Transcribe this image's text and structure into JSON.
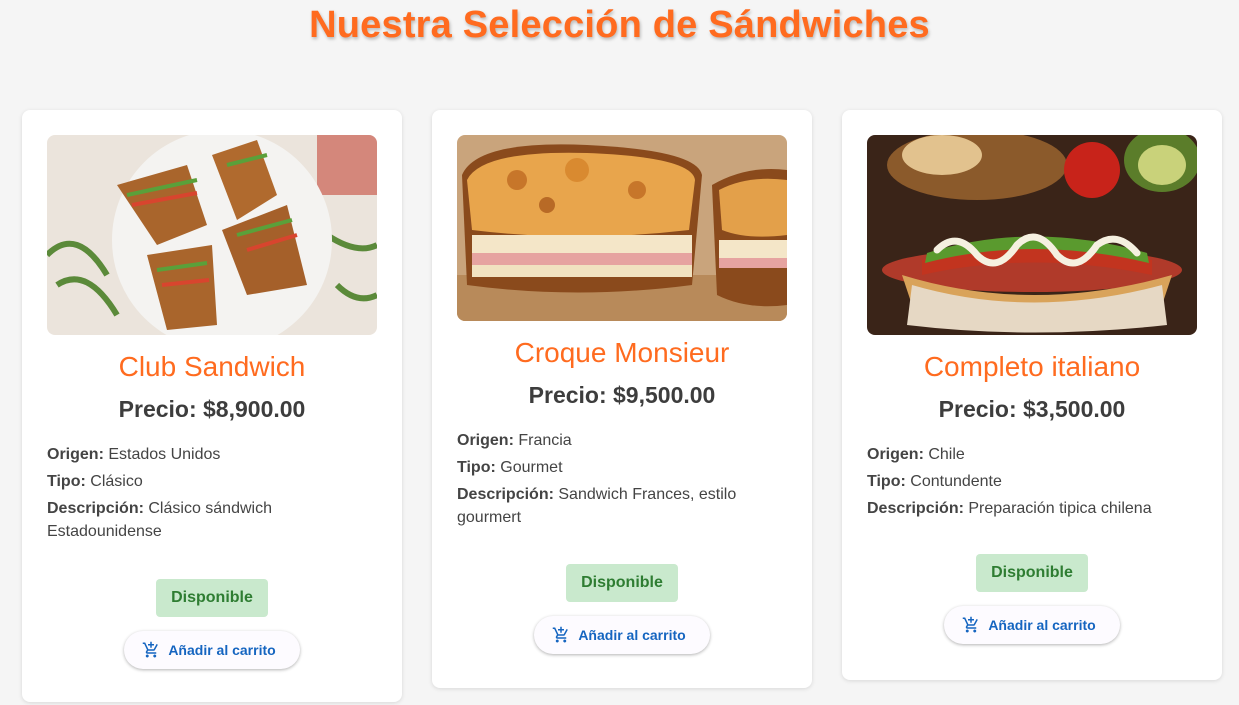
{
  "page": {
    "title": "Nuestra Selección de Sándwiches"
  },
  "labels": {
    "origin": "Origen:",
    "type": "Tipo:",
    "description": "Descripción:"
  },
  "products": [
    {
      "name": "Club Sandwich",
      "price": "Precio: $8,900.00",
      "origin": "Estados Unidos",
      "type": "Clásico",
      "description": "Clásico sándwich Estadounidense",
      "status": "Disponible",
      "cart_label": "Añadir al carrito",
      "image_icon": "club-sandwich-photo"
    },
    {
      "name": "Croque Monsieur",
      "price": "Precio: $9,500.00",
      "origin": "Francia",
      "type": "Gourmet",
      "description": "Sandwich Frances, estilo gourmert",
      "status": "Disponible",
      "cart_label": "Añadir al carrito",
      "image_icon": "croque-monsieur-photo"
    },
    {
      "name": "Completo italiano",
      "price": "Precio: $3,500.00",
      "origin": "Chile",
      "type": "Contundente",
      "description": "Preparación tipica chilena",
      "status": "Disponible",
      "cart_label": "Añadir al carrito",
      "image_icon": "completo-italiano-photo"
    }
  ],
  "colors": {
    "accent": "#ff6b1f",
    "status_bg": "#c9e9cd",
    "status_text": "#2e7d32",
    "button_text": "#1565c0"
  }
}
